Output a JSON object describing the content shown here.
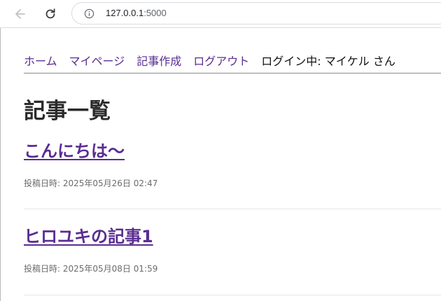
{
  "browser": {
    "url_host": "127.0.0.1",
    "url_port": ":5000",
    "back_icon": "arrow-left",
    "reload_icon": "reload",
    "info_icon": "info-circle"
  },
  "nav": {
    "home": "ホーム",
    "mypage": "マイページ",
    "create": "記事作成",
    "logout": "ログアウト",
    "login_status": "ログイン中: マイケル さん"
  },
  "page": {
    "title": "記事一覧"
  },
  "articles": [
    {
      "title": "こんにちは〜",
      "date": "投稿日時: 2025年05月26日 02:47"
    },
    {
      "title": "ヒロユキの記事1",
      "date": "投稿日時: 2025年05月08日 01:59"
    }
  ],
  "colors": {
    "link": "#5a2d91",
    "text": "#2b2b2b",
    "muted": "#6b6b6b"
  }
}
